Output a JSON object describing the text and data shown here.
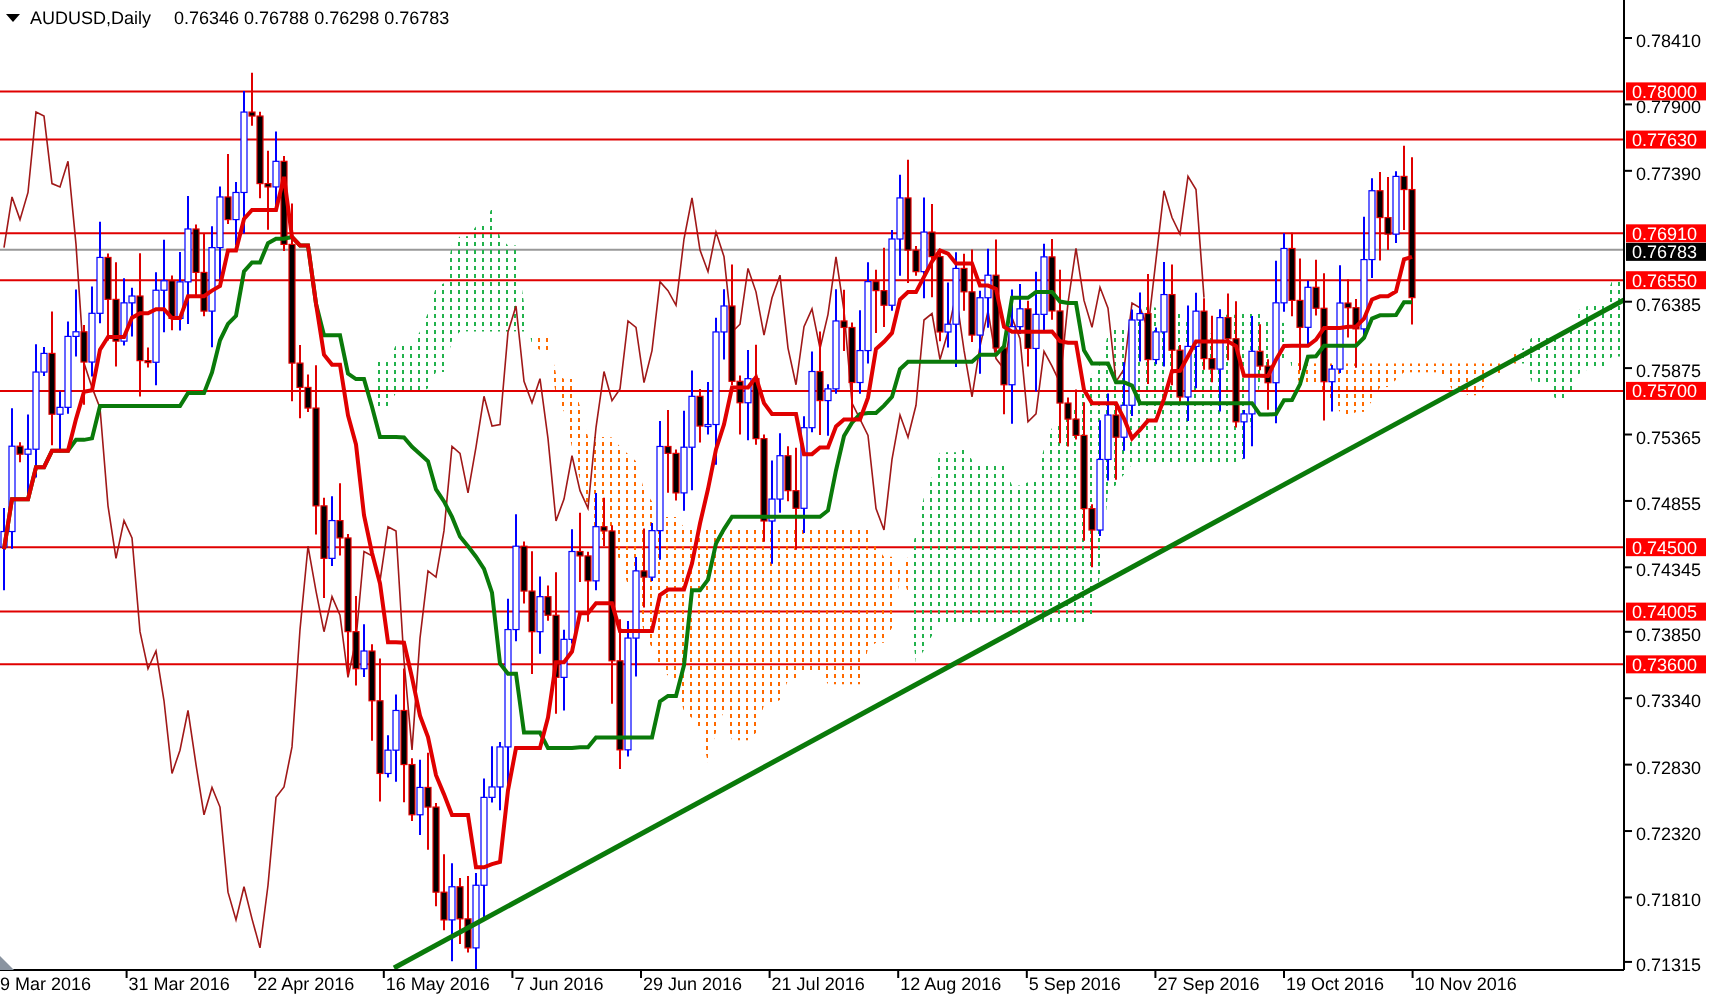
{
  "header": {
    "symbol": "AUDUSD,Daily",
    "prices": "0.76346 0.76788 0.76298 0.76783"
  },
  "price_axis": [
    "0.78410",
    "0.77900",
    "0.77390",
    "0.76385",
    "0.75875",
    "0.75365",
    "0.74855",
    "0.74345",
    "0.73850",
    "0.73340",
    "0.72830",
    "0.72320",
    "0.71810",
    "0.71315"
  ],
  "levels": [
    "0.78000",
    "0.77630",
    "0.76910",
    "0.76550",
    "0.75700",
    "0.74500",
    "0.74005",
    "0.73600"
  ],
  "current_price": "0.76783",
  "date_axis": [
    "9 Mar 2016",
    "31 Mar 2016",
    "22 Apr 2016",
    "16 May 2016",
    "7 Jun 2016",
    "29 Jun 2016",
    "21 Jul 2016",
    "12 Aug 2016",
    "5 Sep 2016",
    "27 Sep 2016",
    "19 Oct 2016",
    "10 Nov 2016"
  ]
}
